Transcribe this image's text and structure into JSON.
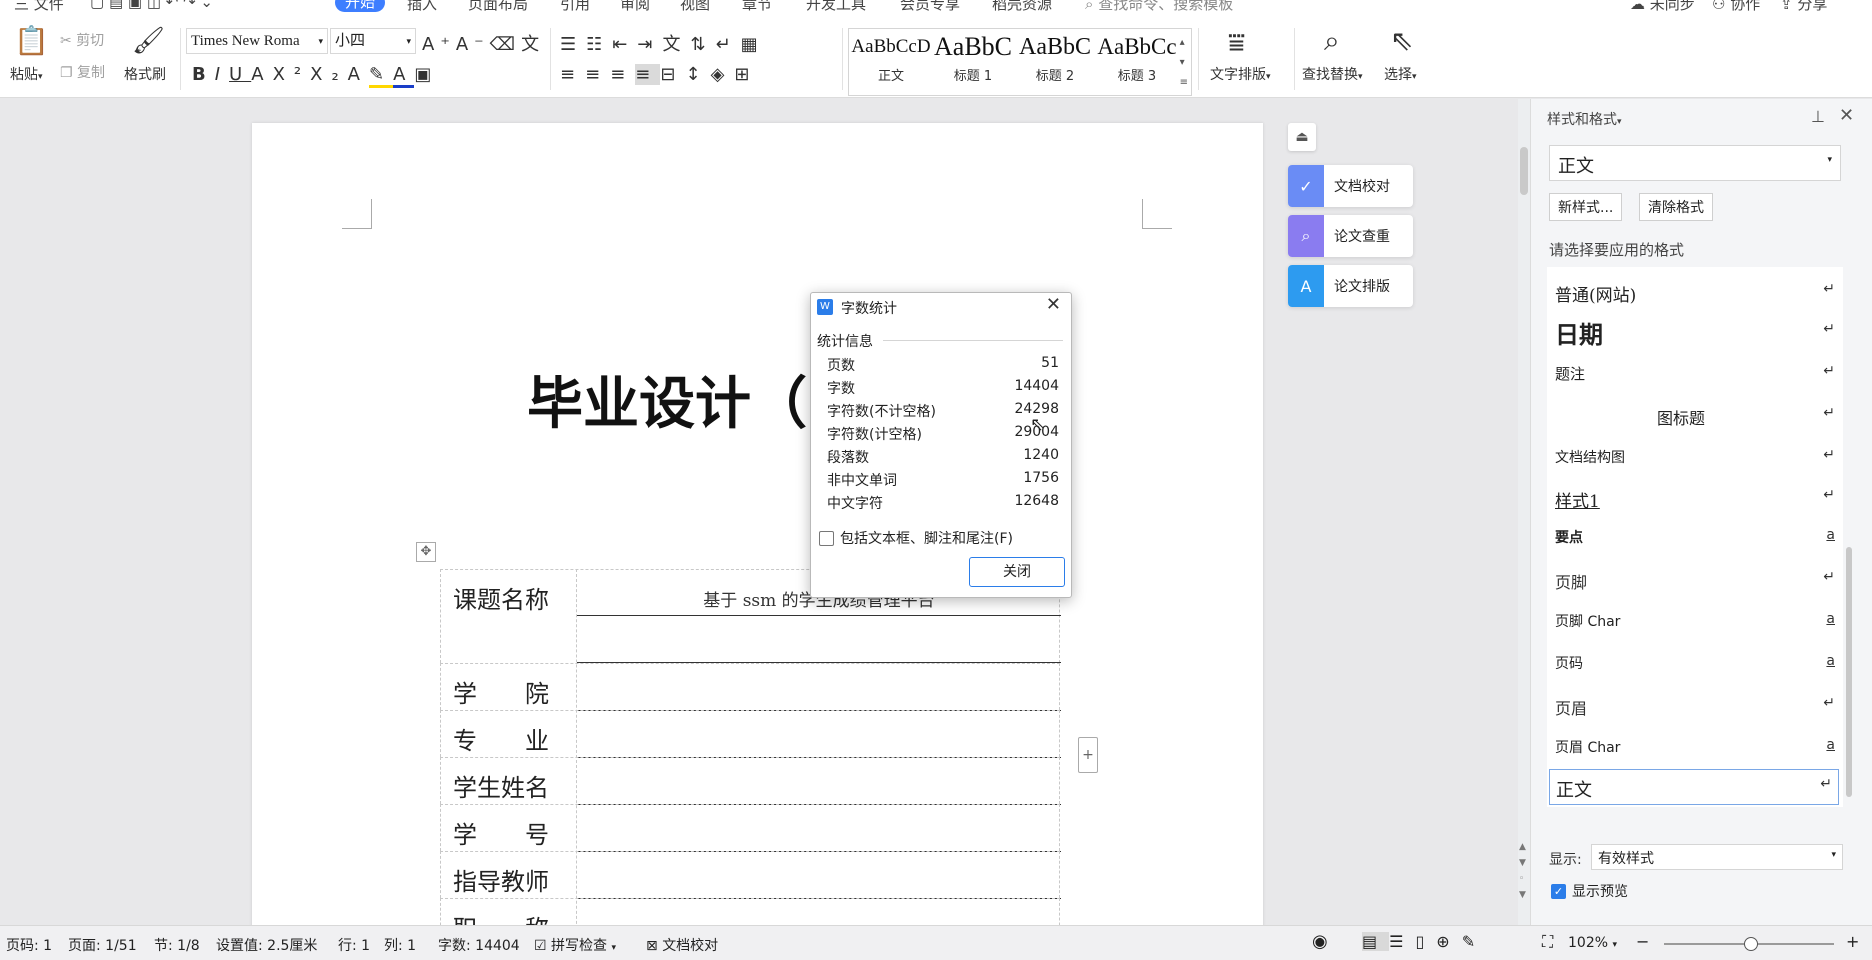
{
  "tabbar": {
    "items": [
      "三 文件",
      "插入",
      "页面布局",
      "引用",
      "审阅",
      "视图",
      "章节",
      "开发工具",
      "会员专享",
      "稻壳资源"
    ],
    "active": "开始",
    "search_placeholder": "查找命令、搜索模板",
    "right_items": [
      "未同步",
      "协作",
      "分享"
    ]
  },
  "ribbon": {
    "paste": "粘贴",
    "cut": "剪切",
    "copy": "复制",
    "format_painter": "格式刷",
    "font_name": "Times New Roma",
    "font_size": "小四",
    "styles": [
      {
        "preview": "AaBbCcD",
        "label": "正文"
      },
      {
        "preview": "AaBbC",
        "label": "标题 1"
      },
      {
        "preview": "AaBbC",
        "label": "标题 2"
      },
      {
        "preview": "AaBbCc",
        "label": "标题 3"
      }
    ],
    "text_layout": "文字排版",
    "find_replace": "查找替换",
    "select": "选择",
    "text_color": "#1a3ec8",
    "highlight_color": "#ffd700"
  },
  "document": {
    "title": "毕业设计（",
    "rows": [
      {
        "label": "课题名称",
        "value": "基于 ssm 的学生成绩管理平台"
      },
      {
        "label": "学　　院",
        "value": ""
      },
      {
        "label": "专　　业",
        "value": ""
      },
      {
        "label": "学生姓名",
        "value": ""
      },
      {
        "label": "学　　号",
        "value": ""
      },
      {
        "label": "指导教师",
        "value": ""
      },
      {
        "label": "职　　称",
        "value": ""
      }
    ]
  },
  "side_tools": [
    {
      "label": "文档校对",
      "color": "#6a8cf5"
    },
    {
      "label": "论文查重",
      "color": "#8a7cf0"
    },
    {
      "label": "论文排版",
      "color": "#2d9bf0"
    }
  ],
  "word_count_dialog": {
    "title": "字数统计",
    "section": "统计信息",
    "stats": [
      {
        "key": "页数",
        "value": "51"
      },
      {
        "key": "字数",
        "value": "14404"
      },
      {
        "key": "字符数(不计空格)",
        "value": "24298"
      },
      {
        "key": "字符数(计空格)",
        "value": "29004"
      },
      {
        "key": "段落数",
        "value": "1240"
      },
      {
        "key": "非中文单词",
        "value": "1756"
      },
      {
        "key": "中文字符",
        "value": "12648"
      }
    ],
    "checkbox_label": "包括文本框、脚注和尾注(F)",
    "close_button": "关闭"
  },
  "style_panel": {
    "title": "样式和格式",
    "current_style": "正文",
    "new_style": "新样式...",
    "clear_format": "清除格式",
    "prompt": "请选择要应用的格式",
    "styles": [
      {
        "name": "普通(网站)",
        "mark": "↵"
      },
      {
        "name": "日期",
        "mark": "↵"
      },
      {
        "name": "题注",
        "mark": "↵"
      },
      {
        "name": "图标题",
        "mark": "↵"
      },
      {
        "name": "文档结构图",
        "mark": "↵"
      },
      {
        "name": "样式1",
        "mark": "↵"
      },
      {
        "name": "要点",
        "mark": "a"
      },
      {
        "name": "页脚",
        "mark": "↵"
      },
      {
        "name": "页脚 Char",
        "mark": "a"
      },
      {
        "name": "页码",
        "mark": "a"
      },
      {
        "name": "页眉",
        "mark": "↵"
      },
      {
        "name": "页眉 Char",
        "mark": "a"
      },
      {
        "name": "正文",
        "mark": "↵"
      }
    ],
    "show_label": "显示:",
    "show_value": "有效样式",
    "preview_label": "显示预览"
  },
  "status_bar": {
    "page_code": "页码: 1",
    "page": "页面: 1/51",
    "section": "节: 1/8",
    "setting": "设置值: 2.5厘米",
    "row": "行: 1",
    "col": "列: 1",
    "word_count": "字数: 14404",
    "spell_check": "拼写检查",
    "doc_check": "文档校对",
    "zoom": "102%"
  }
}
